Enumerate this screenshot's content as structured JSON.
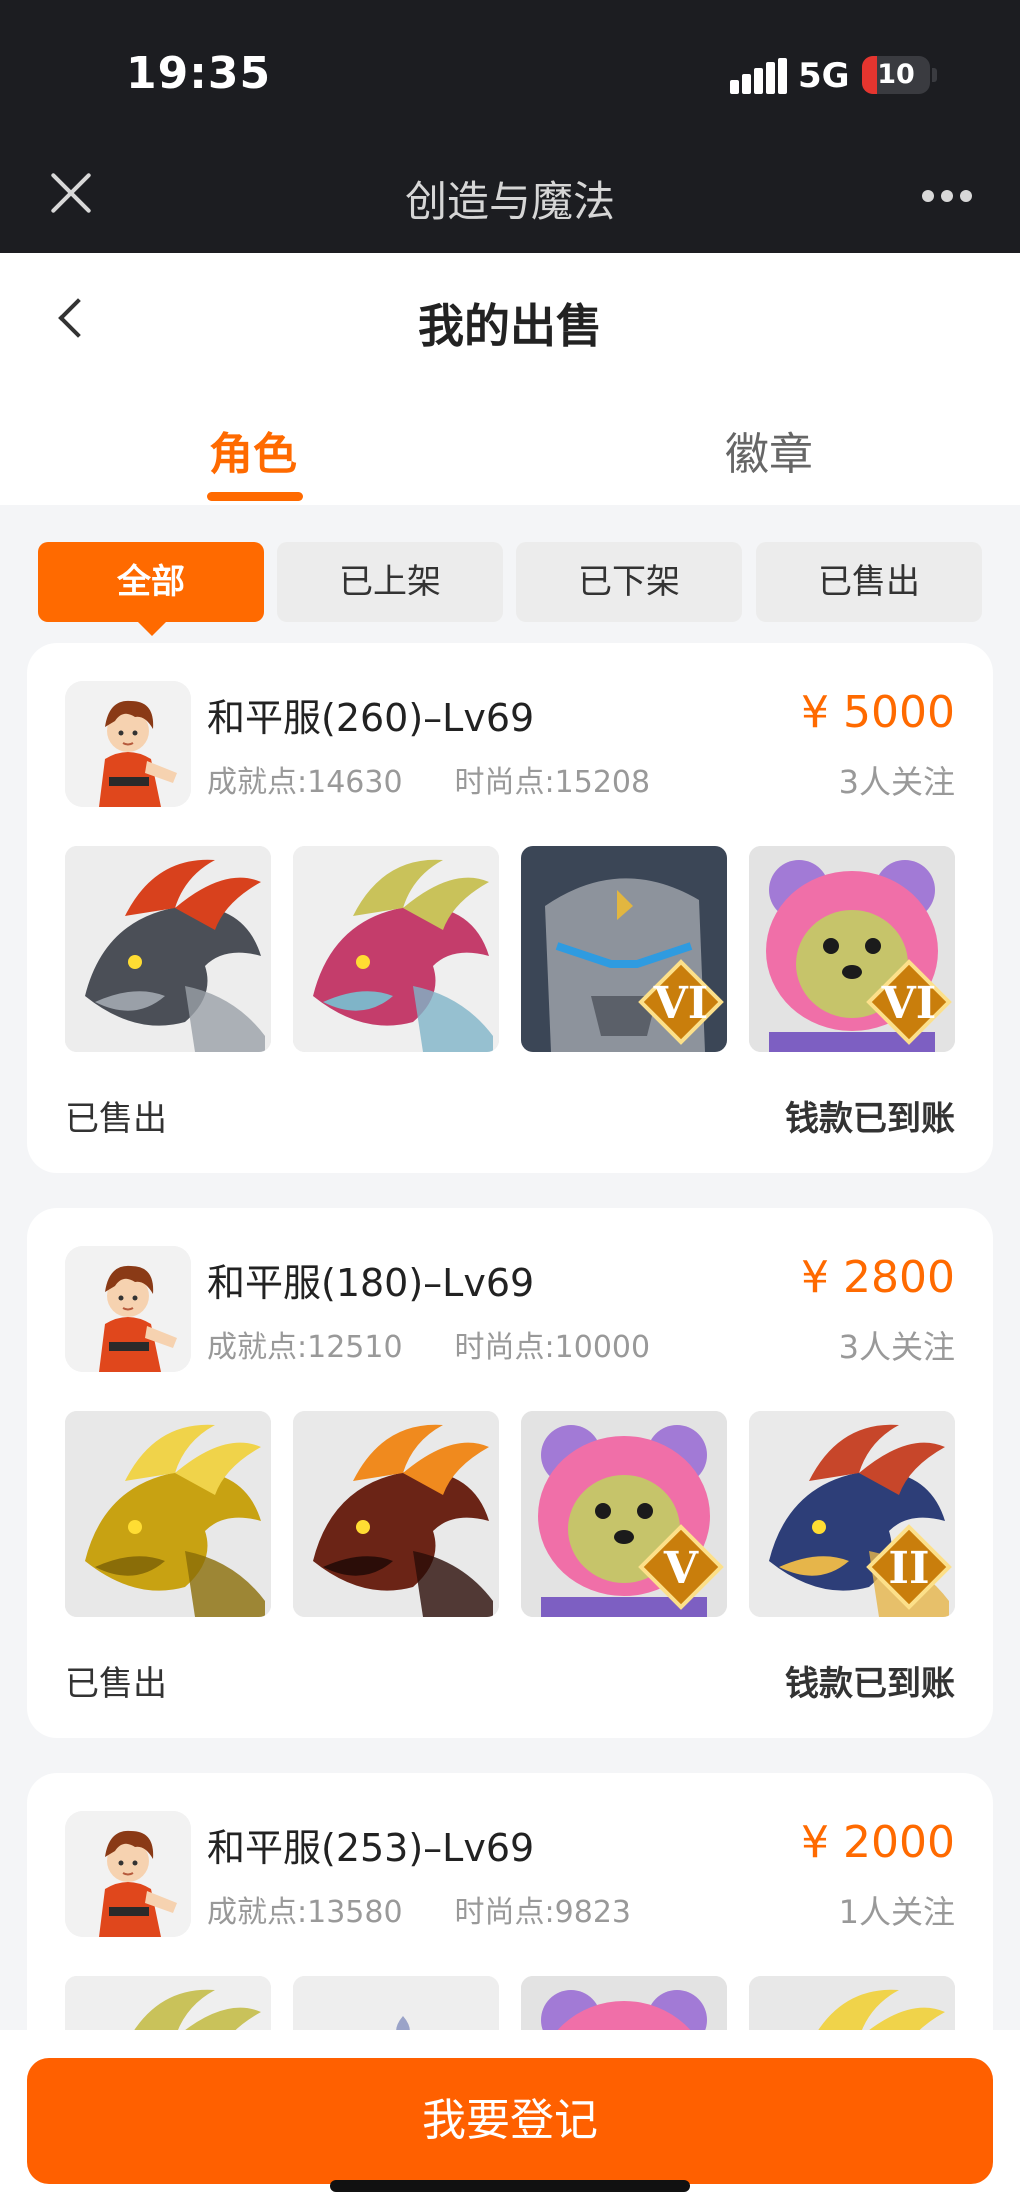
{
  "status_bar": {
    "time": "19:35",
    "network": "5G",
    "battery": "10",
    "battery_fraction": 0.1
  },
  "app_bar": {
    "title": "创造与魔法",
    "close_icon": "close-icon",
    "more_icon": "more-dots-icon"
  },
  "header": {
    "title": "我的出售",
    "back_icon": "chevron-left-icon"
  },
  "tabs": [
    {
      "label": "角色",
      "active": true
    },
    {
      "label": "徽章",
      "active": false
    }
  ],
  "filters": [
    {
      "label": "全部",
      "active": true
    },
    {
      "label": "已上架",
      "active": false
    },
    {
      "label": "已下架",
      "active": false
    },
    {
      "label": "已售出",
      "active": false
    }
  ],
  "listings": [
    {
      "name": "和平服(260)–Lv69",
      "achievement": "成就点:14630",
      "fashion": "时尚点:15208",
      "price": "¥ 5000",
      "followers": "3人关注",
      "status": "已售出",
      "payment": "钱款已到账",
      "items": [
        {
          "type": "gray-dragon",
          "badge": ""
        },
        {
          "type": "pink-dragon",
          "badge": ""
        },
        {
          "type": "stone-golem",
          "badge": "VI"
        },
        {
          "type": "pink-bear",
          "badge": "VI"
        }
      ]
    },
    {
      "name": "和平服(180)–Lv69",
      "achievement": "成就点:12510",
      "fashion": "时尚点:10000",
      "price": "¥ 2800",
      "followers": "3人关注",
      "status": "已售出",
      "payment": "钱款已到账",
      "items": [
        {
          "type": "gold-dragon",
          "badge": ""
        },
        {
          "type": "fire-dragon",
          "badge": ""
        },
        {
          "type": "pink-bear",
          "badge": "V"
        },
        {
          "type": "blue-dragon",
          "badge": "II"
        }
      ]
    },
    {
      "name": "和平服(253)–Lv69",
      "achievement": "成就点:13580",
      "fashion": "时尚点:9823",
      "price": "¥ 2000",
      "followers": "1人关注",
      "status": "",
      "payment": "",
      "items": [
        {
          "type": "pink-dragon",
          "badge": ""
        },
        {
          "type": "white-creature",
          "badge": ""
        },
        {
          "type": "pink-bear",
          "badge": ""
        },
        {
          "type": "gold-dragon",
          "badge": ""
        }
      ]
    }
  ],
  "footer": {
    "button_label": "我要登记"
  },
  "colors": {
    "accent": "#ff6a00",
    "dark_bar": "#1c1d21",
    "muted_text": "#999999"
  }
}
